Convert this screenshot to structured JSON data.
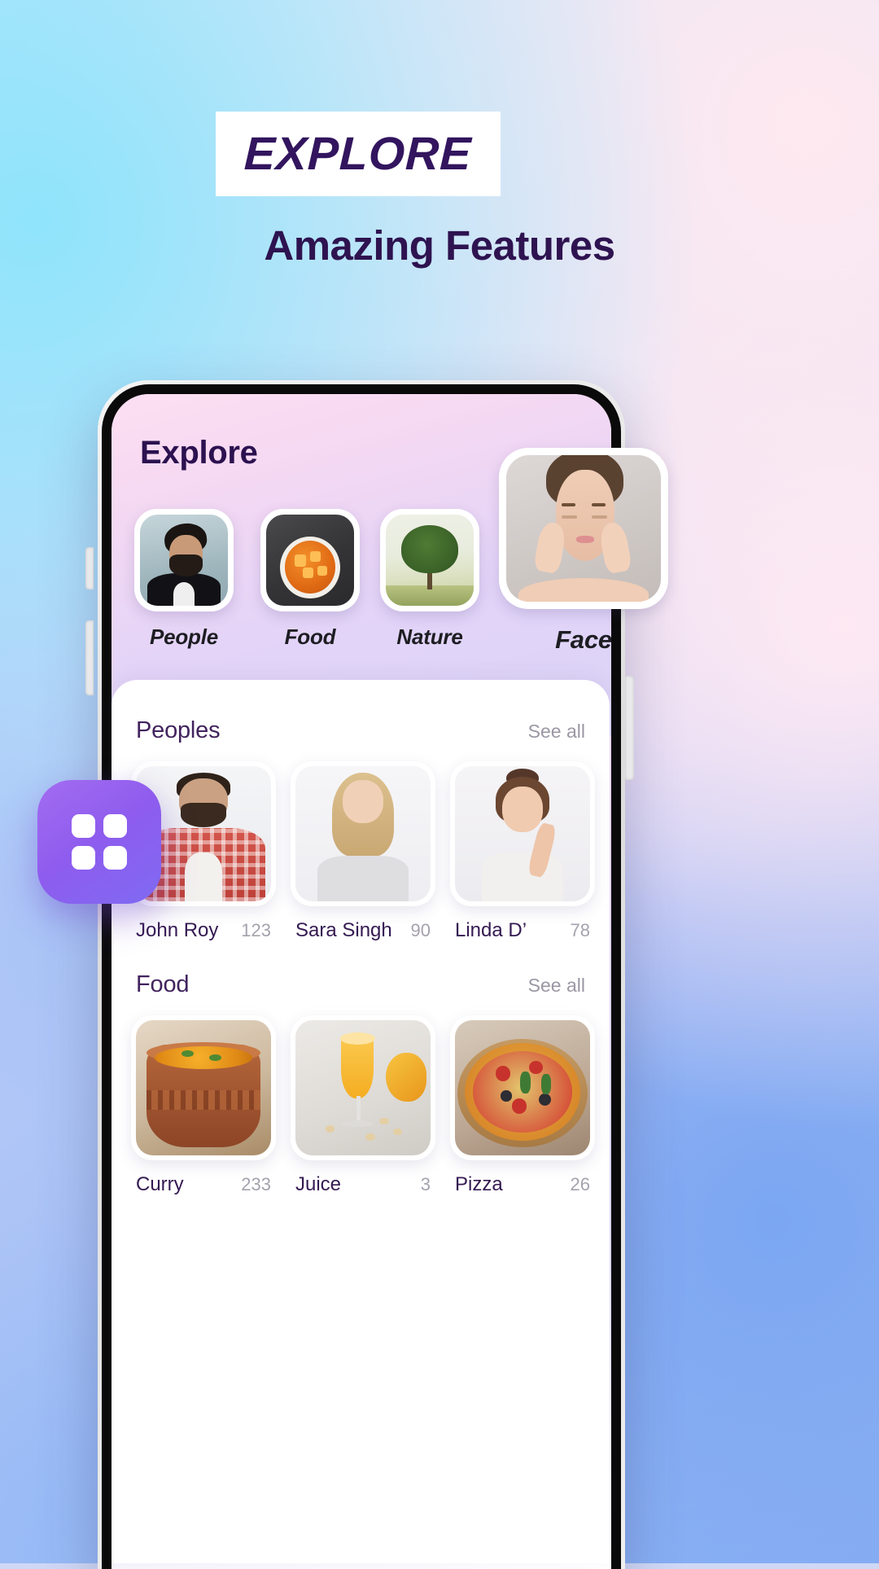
{
  "promo": {
    "badge_title": "EXPLORE",
    "subtitle": "Amazing Features",
    "accent_color": "#2e1350",
    "badge_bg": "#ffffff"
  },
  "app": {
    "icon_name": "grid-app-icon",
    "icon_color": "#8e5cee",
    "screen": {
      "header_title": "Explore",
      "categories": [
        {
          "label": "People",
          "image": "man-in-suit-photo",
          "selected": false
        },
        {
          "label": "Food",
          "image": "curry-bowl-photo",
          "selected": false
        },
        {
          "label": "Nature",
          "image": "tree-field-photo",
          "selected": false
        },
        {
          "label": "Face",
          "image": "woman-skincare-photo",
          "selected": true
        }
      ],
      "sections": [
        {
          "title": "Peoples",
          "see_all": "See all",
          "items": [
            {
              "name": "John Roy",
              "count": "123",
              "image": "bearded-man-plaid-shirt-photo"
            },
            {
              "name": "Sara Singh",
              "count": "90",
              "image": "blonde-woman-photo"
            },
            {
              "name": "Linda D’",
              "count": "78",
              "image": "woman-bun-hairstyle-photo"
            }
          ]
        },
        {
          "title": "Food",
          "see_all": "See all",
          "items": [
            {
              "name": "Curry",
              "count": "233",
              "image": "curry-clay-pot-photo"
            },
            {
              "name": "Juice",
              "count": "3",
              "image": "mango-juice-glass-photo"
            },
            {
              "name": "Pizza",
              "count": "26",
              "image": "pizza-on-board-photo"
            }
          ]
        }
      ]
    }
  }
}
